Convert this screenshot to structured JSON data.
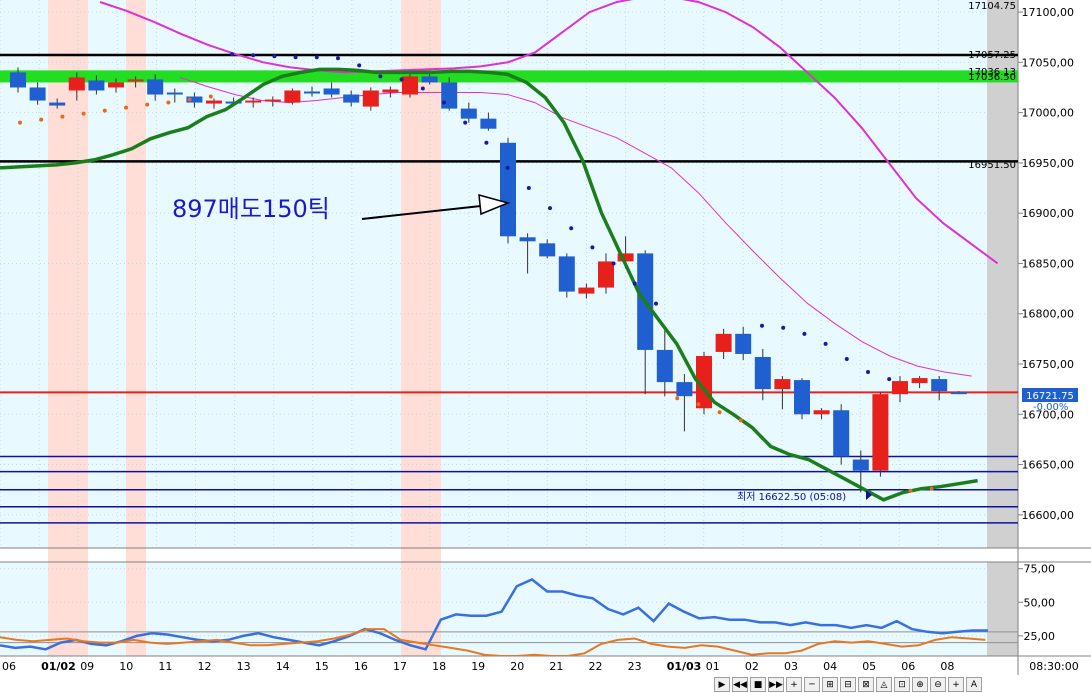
{
  "annotation": {
    "text": "897매도150틱"
  },
  "low_marker": {
    "text": "최저 16622.50 (05:08)"
  },
  "current_price": {
    "value": "16721.75",
    "change": "-0.00%"
  },
  "level_labels": [
    "17104.75",
    "17057.25",
    "17036.50",
    "17036.13",
    "16951.50"
  ],
  "time_readout": "08:30:00",
  "colors": {
    "background": "#E8FAFF",
    "up_candle": "#E8201C",
    "down_candle": "#1F5FD0",
    "ma_green": "#1A7F1A",
    "envelope": "#E030D0",
    "sar_up": "#E86A1C",
    "sar_down": "#1A1A9F",
    "current_line": "#E8201C",
    "support_lines": "#1010A0",
    "green_band": "#22DD22",
    "osc_blue": "#3A6FE0",
    "osc_orange": "#E87820"
  },
  "toolbar": {
    "buttons": [
      "▶",
      "◀◀",
      "■",
      "▶▶",
      "+",
      "─",
      "⊞",
      "⊟",
      "⊠",
      "◬",
      "⊡",
      "⊕",
      "⊖",
      "+",
      "A"
    ]
  },
  "chart_data": [
    {
      "type": "candlestick",
      "title": "",
      "y_axis": {
        "min": 16570,
        "max": 17110,
        "ticks": [
          17100,
          17050,
          17000,
          16950,
          16900,
          16850,
          16800,
          16750,
          16700,
          16650,
          16600
        ],
        "tick_labels": [
          "17100,00",
          "17050,00",
          "17000,00",
          "16950,00",
          "16900,00",
          "16850,00",
          "16800,00",
          "16750,00",
          "16700,00",
          "16650,00",
          "16600,00"
        ]
      },
      "x_labels": [
        "06",
        "01/02",
        "09",
        "10",
        "11",
        "12",
        "13",
        "14",
        "15",
        "16",
        "17",
        "18",
        "19",
        "20",
        "21",
        "22",
        "23",
        "01/03",
        "01",
        "02",
        "03",
        "04",
        "05",
        "06",
        "08"
      ],
      "candles": [
        {
          "o": 17040,
          "h": 17045,
          "l": 17020,
          "c": 17025
        },
        {
          "o": 17025,
          "h": 17030,
          "l": 17008,
          "c": 17012
        },
        {
          "o": 17010,
          "h": 17014,
          "l": 17004,
          "c": 17007
        },
        {
          "o": 17022,
          "h": 17040,
          "l": 17012,
          "c": 17035
        },
        {
          "o": 17032,
          "h": 17037,
          "l": 17018,
          "c": 17022
        },
        {
          "o": 17025,
          "h": 17034,
          "l": 17020,
          "c": 17030
        },
        {
          "o": 17031,
          "h": 17036,
          "l": 17025,
          "c": 17033
        },
        {
          "o": 17033,
          "h": 17038,
          "l": 17012,
          "c": 17018
        },
        {
          "o": 17020,
          "h": 17024,
          "l": 17010,
          "c": 17018
        },
        {
          "o": 17016,
          "h": 17020,
          "l": 17005,
          "c": 17010
        },
        {
          "o": 17009,
          "h": 17014,
          "l": 17004,
          "c": 17012
        },
        {
          "o": 17011,
          "h": 17015,
          "l": 17006,
          "c": 17010
        },
        {
          "o": 17010,
          "h": 17015,
          "l": 17005,
          "c": 17012
        },
        {
          "o": 17011,
          "h": 17016,
          "l": 17006,
          "c": 17013
        },
        {
          "o": 17010,
          "h": 17024,
          "l": 17008,
          "c": 17022
        },
        {
          "o": 17021,
          "h": 17026,
          "l": 17016,
          "c": 17020
        },
        {
          "o": 17024,
          "h": 17030,
          "l": 17015,
          "c": 17018
        },
        {
          "o": 17018,
          "h": 17022,
          "l": 17006,
          "c": 17010
        },
        {
          "o": 17006,
          "h": 17025,
          "l": 17002,
          "c": 17022
        },
        {
          "o": 17020,
          "h": 17026,
          "l": 17015,
          "c": 17023
        },
        {
          "o": 17018,
          "h": 17040,
          "l": 17015,
          "c": 17036
        },
        {
          "o": 17036,
          "h": 17042,
          "l": 17028,
          "c": 17030
        },
        {
          "o": 17030,
          "h": 17035,
          "l": 17002,
          "c": 17004
        },
        {
          "o": 17004,
          "h": 17010,
          "l": 16990,
          "c": 16994
        },
        {
          "o": 16994,
          "h": 17000,
          "l": 16982,
          "c": 16984
        },
        {
          "o": 16970,
          "h": 16975,
          "l": 16870,
          "c": 16877
        },
        {
          "o": 16876,
          "h": 16880,
          "l": 16840,
          "c": 16872
        },
        {
          "o": 16870,
          "h": 16874,
          "l": 16855,
          "c": 16857
        },
        {
          "o": 16857,
          "h": 16860,
          "l": 16816,
          "c": 16822
        },
        {
          "o": 16820,
          "h": 16830,
          "l": 16815,
          "c": 16826
        },
        {
          "o": 16826,
          "h": 16860,
          "l": 16820,
          "c": 16852
        },
        {
          "o": 16852,
          "h": 16877,
          "l": 16845,
          "c": 16860
        },
        {
          "o": 16860,
          "h": 16863,
          "l": 16720,
          "c": 16764
        },
        {
          "o": 16764,
          "h": 16785,
          "l": 16718,
          "c": 16732
        },
        {
          "o": 16732,
          "h": 16740,
          "l": 16683,
          "c": 16718
        },
        {
          "o": 16706,
          "h": 16762,
          "l": 16700,
          "c": 16758
        },
        {
          "o": 16762,
          "h": 16785,
          "l": 16755,
          "c": 16780
        },
        {
          "o": 16780,
          "h": 16787,
          "l": 16754,
          "c": 16760
        },
        {
          "o": 16757,
          "h": 16765,
          "l": 16714,
          "c": 16725
        },
        {
          "o": 16725,
          "h": 16738,
          "l": 16705,
          "c": 16735
        },
        {
          "o": 16734,
          "h": 16736,
          "l": 16695,
          "c": 16700
        },
        {
          "o": 16700,
          "h": 16706,
          "l": 16695,
          "c": 16704
        },
        {
          "o": 16704,
          "h": 16710,
          "l": 16650,
          "c": 16658
        },
        {
          "o": 16655,
          "h": 16664,
          "l": 16622.5,
          "c": 16644
        },
        {
          "o": 16644,
          "h": 16722,
          "l": 16638,
          "c": 16720
        },
        {
          "o": 16720,
          "h": 16738,
          "l": 16712,
          "c": 16733
        },
        {
          "o": 16731,
          "h": 16738,
          "l": 16726,
          "c": 16736
        },
        {
          "o": 16735,
          "h": 16738,
          "l": 16714,
          "c": 16723
        },
        {
          "o": 16722,
          "h": 16723,
          "l": 16720,
          "c": 16721.75
        }
      ],
      "green_ma": [
        16945,
        16946,
        16947,
        16948,
        16950,
        16953,
        16958,
        16964,
        16974,
        16980,
        16985,
        16996,
        17003,
        17015,
        17028,
        17036,
        17040,
        17043,
        17043,
        17042,
        17040,
        17040,
        17040,
        17040,
        17041,
        17041,
        17040,
        17038,
        17030,
        17015,
        16990,
        16952,
        16900,
        16860,
        16820,
        16795,
        16770,
        16735,
        16712,
        16700,
        16687,
        16668,
        16660,
        16655,
        16645,
        16635,
        16625,
        16615,
        16622,
        16626,
        16628,
        16631,
        16634
      ],
      "envelope_top": [
        17110,
        17101,
        17090,
        17078,
        17067,
        17058,
        17050,
        17045,
        17042,
        17040,
        17041,
        17042,
        17043,
        17044,
        17046,
        17050,
        17060,
        17080,
        17100,
        17110,
        17115,
        17115,
        17110,
        17100,
        17085,
        17065,
        17040,
        17015,
        16985,
        16950,
        16915,
        16890,
        16870,
        16850
      ],
      "envelope_mid": [
        17035,
        17026,
        17018,
        17012,
        17010,
        17012,
        17015,
        17018,
        17020,
        17020,
        17020,
        17020,
        17018,
        17010,
        16995,
        16985,
        16975,
        16960,
        16945,
        16920,
        16890,
        16862,
        16835,
        16810,
        16790,
        16772,
        16758,
        16748,
        16742,
        16738
      ],
      "sar": [
        {
          "v": 16990,
          "pos": "below"
        },
        {
          "v": 16993,
          "pos": "below"
        },
        {
          "v": 16996,
          "pos": "below"
        },
        {
          "v": 16999,
          "pos": "below"
        },
        {
          "v": 17002,
          "pos": "below"
        },
        {
          "v": 17005,
          "pos": "below"
        },
        {
          "v": 17008,
          "pos": "below"
        },
        {
          "v": 17010,
          "pos": "below"
        },
        {
          "v": 17013,
          "pos": "below"
        },
        {
          "v": 17016,
          "pos": "below"
        },
        {
          "v": 17058,
          "pos": "above"
        },
        {
          "v": 17057,
          "pos": "above"
        },
        {
          "v": 17056,
          "pos": "above"
        },
        {
          "v": 17055,
          "pos": "above"
        },
        {
          "v": 17055,
          "pos": "above"
        },
        {
          "v": 17054,
          "pos": "above"
        },
        {
          "v": 17047,
          "pos": "above"
        },
        {
          "v": 17036,
          "pos": "above"
        },
        {
          "v": 17033,
          "pos": "above"
        },
        {
          "v": 17024,
          "pos": "above"
        },
        {
          "v": 17010,
          "pos": "above"
        },
        {
          "v": 16990,
          "pos": "above"
        },
        {
          "v": 16970,
          "pos": "above"
        },
        {
          "v": 16945,
          "pos": "above"
        },
        {
          "v": 16925,
          "pos": "above"
        },
        {
          "v": 16905,
          "pos": "above"
        },
        {
          "v": 16885,
          "pos": "above"
        },
        {
          "v": 16866,
          "pos": "above"
        },
        {
          "v": 16850,
          "pos": "above"
        },
        {
          "v": 16830,
          "pos": "above"
        },
        {
          "v": 16810,
          "pos": "above"
        },
        {
          "v": 16716,
          "pos": "below"
        },
        {
          "v": 16710,
          "pos": "below"
        },
        {
          "v": 16702,
          "pos": "below"
        },
        {
          "v": 16694,
          "pos": "below"
        },
        {
          "v": 16788,
          "pos": "above"
        },
        {
          "v": 16786,
          "pos": "above"
        },
        {
          "v": 16780,
          "pos": "above"
        },
        {
          "v": 16770,
          "pos": "above"
        },
        {
          "v": 16755,
          "pos": "above"
        },
        {
          "v": 16742,
          "pos": "above"
        },
        {
          "v": 16735,
          "pos": "above"
        },
        {
          "v": 16624,
          "pos": "below"
        },
        {
          "v": 16626,
          "pos": "below"
        }
      ],
      "horizontal_lines": [
        {
          "value": 17057.25,
          "color": "black",
          "width": 2.5
        },
        {
          "value": 16951.5,
          "color": "black",
          "width": 2.5
        },
        {
          "value": 16721.75,
          "color": "red",
          "width": 2
        },
        {
          "value": 16658,
          "color": "blue",
          "width": 1.5
        },
        {
          "value": 16643,
          "color": "blue",
          "width": 1.5
        },
        {
          "value": 16625,
          "color": "blue",
          "width": 1.5
        },
        {
          "value": 16608,
          "color": "blue",
          "width": 1.5
        },
        {
          "value": 16592,
          "color": "blue",
          "width": 1.5
        }
      ],
      "green_band": [
        17030,
        17042
      ]
    },
    {
      "type": "line",
      "title": "",
      "y_axis": {
        "min": 10,
        "max": 80,
        "ticks": [
          75,
          50,
          25
        ],
        "tick_labels": [
          "75,00",
          "50,00",
          "25,00"
        ]
      },
      "series": [
        {
          "values": [
            18,
            16,
            17,
            15,
            20,
            22,
            19,
            18,
            21,
            25,
            27,
            26,
            24,
            22,
            21,
            22,
            25,
            27,
            24,
            22,
            20,
            18,
            21,
            25,
            30,
            27,
            22,
            18,
            15,
            37,
            41,
            40,
            40,
            43,
            62,
            67,
            58,
            58,
            55,
            53,
            45,
            41,
            46,
            36,
            49,
            43,
            38,
            39,
            37,
            37,
            35,
            35,
            33,
            35,
            33,
            33,
            31,
            33,
            31,
            36,
            30,
            28,
            27,
            28,
            29,
            29
          ]
        },
        {
          "values": [
            24,
            22,
            21,
            22,
            23,
            21,
            20,
            20,
            22,
            20,
            19,
            20,
            21,
            22,
            20,
            18,
            18,
            19,
            20,
            21,
            23,
            26,
            30,
            30,
            22,
            20,
            18,
            16,
            14,
            11,
            10,
            10,
            11,
            10,
            10,
            12,
            19,
            22,
            23,
            19,
            17,
            16,
            18,
            17,
            14,
            11,
            12,
            12,
            14,
            19,
            21,
            20,
            21,
            19,
            17,
            18,
            22,
            24,
            23,
            22
          ]
        }
      ]
    }
  ]
}
